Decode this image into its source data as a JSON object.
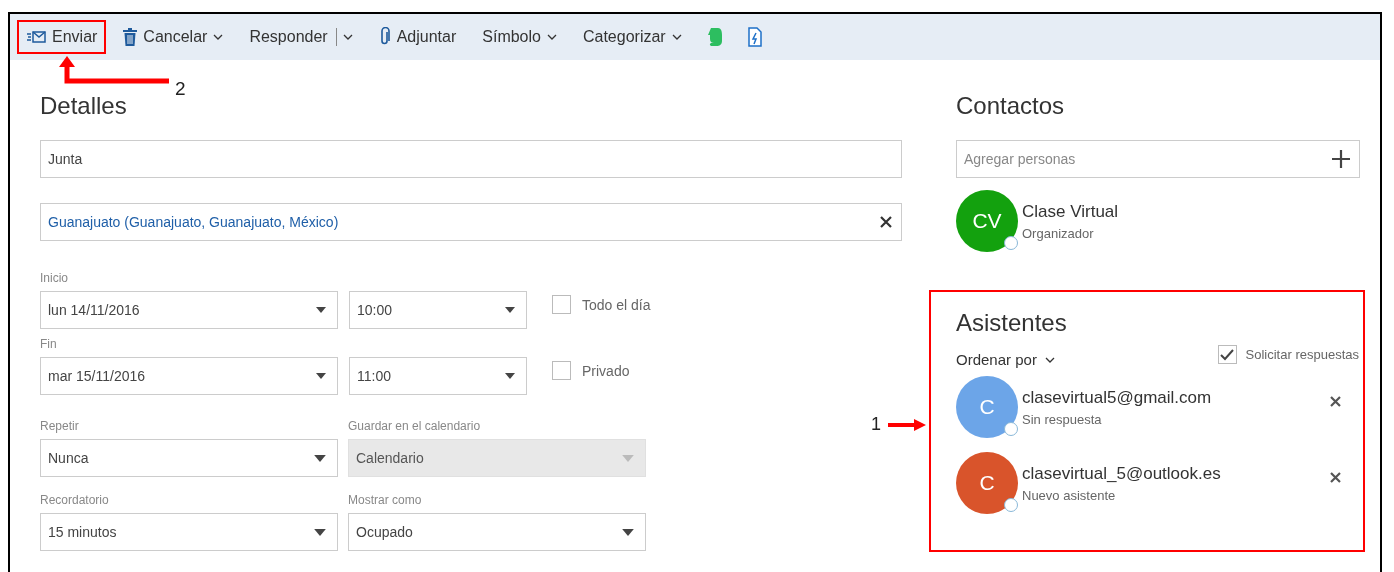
{
  "toolbar": [
    {
      "kind": "text",
      "label": "Enviar",
      "dropdown": false,
      "split": false,
      "highlighted": true,
      "callout": "2"
    },
    {
      "kind": "text",
      "label": "Cancelar",
      "dropdown": true,
      "split": false,
      "highlighted": false
    },
    {
      "kind": "text",
      "label": "Responder",
      "dropdown": true,
      "split": true,
      "highlighted": false
    },
    {
      "kind": "text",
      "label": "Adjuntar",
      "dropdown": false,
      "split": false,
      "highlighted": false
    },
    {
      "kind": "text",
      "label": "Símbolo",
      "dropdown": true,
      "split": false,
      "highlighted": false
    },
    {
      "kind": "text",
      "label": "Categorizar",
      "dropdown": true,
      "split": false,
      "highlighted": false
    },
    {
      "kind": "icon",
      "dropdown": false,
      "split": false,
      "highlighted": false
    },
    {
      "kind": "icon",
      "dropdown": false,
      "split": false,
      "highlighted": false
    }
  ],
  "details": {
    "heading": "Detalles",
    "title": "Junta",
    "location": "Guanajuato (Guanajuato, Guanajuato, México)",
    "start": {
      "label": "Inicio",
      "date": "lun 14/11/2016",
      "time": "10:00",
      "option": {
        "label": "Todo el día",
        "checked": false
      }
    },
    "end": {
      "label": "Fin",
      "date": "mar 15/11/2016",
      "time": "11:00",
      "option": {
        "label": "Privado",
        "checked": false
      }
    },
    "selects": [
      {
        "label": "Repetir",
        "value": "Nunca",
        "disabled": false
      },
      {
        "label": "Guardar en el calendario",
        "value": "Calendario",
        "disabled": true
      },
      {
        "label": "Recordatorio",
        "value": "15 minutos",
        "disabled": false
      },
      {
        "label": "Mostrar como",
        "value": "Ocupado",
        "disabled": false
      }
    ]
  },
  "contacts": {
    "heading": "Contactos",
    "placeholder": "Agregar personas",
    "organizer": {
      "initials": "CV",
      "name": "Clase Virtual",
      "role": "Organizador",
      "color": "#13a10e"
    }
  },
  "attendees": {
    "heading": "Asistentes",
    "highlighted": true,
    "callout": "1",
    "sort_label": "Ordenar por",
    "request_responses": {
      "label": "Solicitar respuestas",
      "checked": true
    },
    "people": [
      {
        "initials": "C",
        "name": "clasevirtual5@gmail.com",
        "status": "Sin respuesta",
        "color": "#6ca5e8"
      },
      {
        "initials": "C",
        "name": "clasevirtual_5@outlook.es",
        "status": "Nuevo asistente",
        "color": "#d9542b"
      }
    ]
  }
}
